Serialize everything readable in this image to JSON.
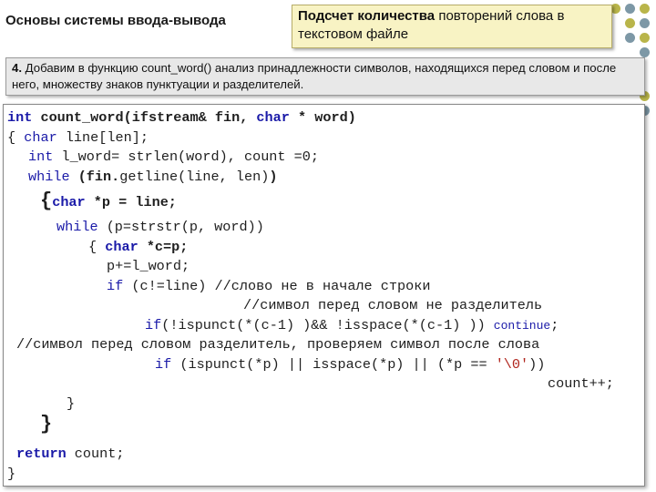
{
  "header": {
    "title": "Основы системы ввода-вывода",
    "callout_bold": "Подсчет количества",
    "callout_rest": " повторений слова в текстовом файле"
  },
  "step": {
    "number": "4.",
    "text": " Добавим в функцию count_word() анализ принадлежности символов, находящихся перед словом и после него, множеству знаков пунктуации и разделителей."
  },
  "code": {
    "kw_int": "int",
    "kw_char": "char",
    "kw_while": "while",
    "kw_if": "if",
    "kw_return": "return",
    "kw_continue": "continue",
    "l1_a": " count_word(ifstream& fin, ",
    "l1_b": " * word)",
    "l2_a": "{ ",
    "l2_b": " line[len];",
    "l3_b": " l_word= strlen(word), count =0;",
    "l4_b": " (fin.",
    "l4_c": "getline(line, len)",
    "l4_d": ")",
    "l5_brace": "{",
    "l5_b": " *p = line;",
    "l6_b": " (p=strstr(p, word))",
    "l7_a": "{ ",
    "l7_b": " *c=p;",
    "l8": "p+=l_word;",
    "l9_b": " (c!=line) ",
    "l9_c": "//слово не в начале строки",
    "l10": "//символ перед словом не разделитель",
    "l11_b": "(!ispunct(*(c-1) )&& !isspace(*(c-1) )) ",
    "l11_d": ";",
    "l12": "//символ перед словом разделитель, проверяем символ после слова",
    "l13_b": " (ispunct(*p) || isspace(*p) || (*p == ",
    "l13_str": "'\\0'",
    "l13_d": "))",
    "l14": "count++;",
    "l15": "}",
    "l16": "}",
    "l17_b": " count;",
    "l18": "}"
  },
  "colors": {
    "keyword": "#1a1aa8",
    "string": "#b0241c",
    "callout_bg": "#f8f3c4",
    "step_bg": "#e8e8e8",
    "dot_olive": "#b9b54a",
    "dot_slate": "#7d98a6"
  }
}
